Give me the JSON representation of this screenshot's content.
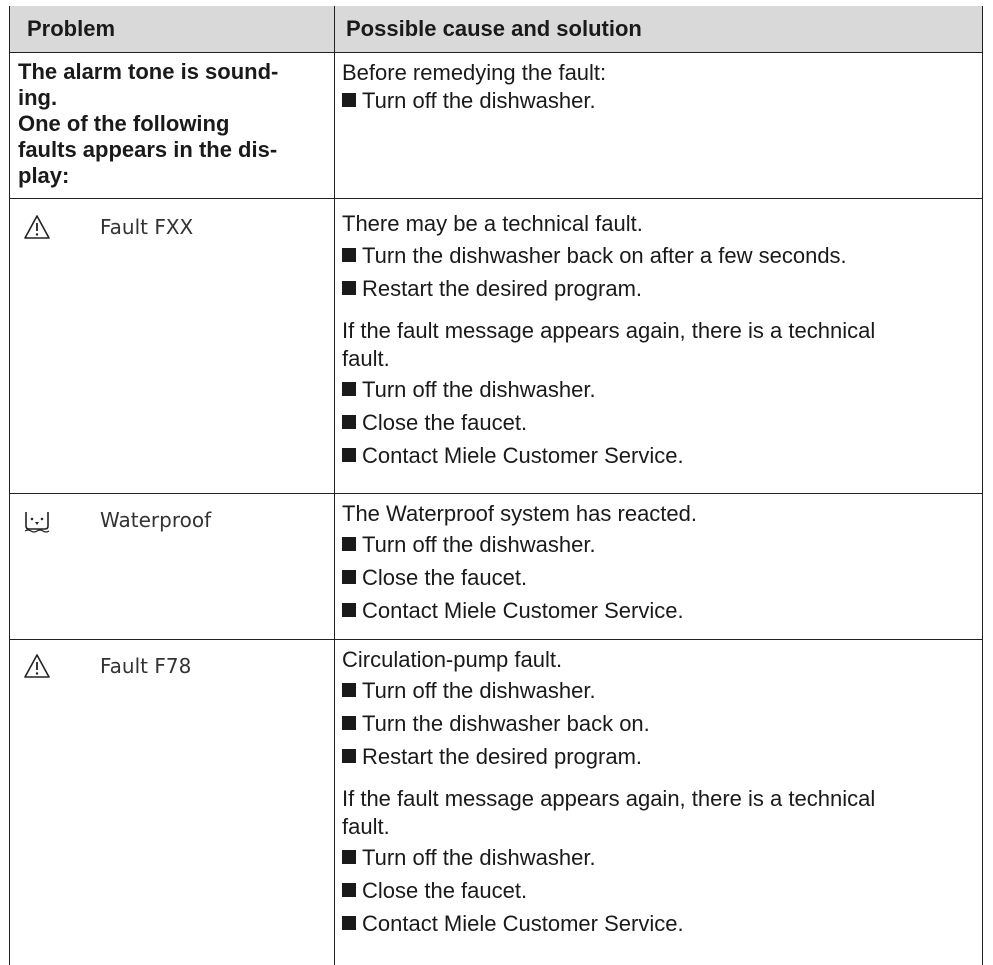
{
  "header": {
    "problem": "Problem",
    "solution": "Possible cause and solution"
  },
  "alarm": {
    "title_lines": [
      "The alarm tone is sound-",
      "ing.",
      "One of the following",
      "faults appears in the dis-",
      "play:"
    ],
    "intro": "Before remedying the fault:",
    "bullets": [
      "Turn off the dishwasher."
    ]
  },
  "fault_fxx": {
    "icon": "warning-triangle-icon",
    "code": "Fault FXX",
    "intro": "There may be a technical fault.",
    "bullets1": [
      "Turn the dishwasher back on after a few seconds.",
      "Restart the desired program."
    ],
    "again_lines": [
      "If the fault message appears again, there is a technical",
      "fault."
    ],
    "bullets2": [
      "Turn off the dishwasher.",
      "Close the faucet.",
      "Contact Miele Customer Service."
    ]
  },
  "waterproof": {
    "icon": "water-basin-icon",
    "code": "Waterproof",
    "intro": "The Waterproof system has reacted.",
    "bullets": [
      "Turn off the dishwasher.",
      "Close the faucet.",
      "Contact Miele Customer Service."
    ]
  },
  "fault_f78": {
    "icon": "warning-triangle-icon",
    "code": "Fault F78",
    "intro": "Circulation-pump fault.",
    "bullets1": [
      "Turn off the dishwasher.",
      "Turn the dishwasher back on.",
      "Restart the desired program."
    ],
    "again_lines": [
      "If the fault message appears again, there is a technical",
      "fault."
    ],
    "bullets2": [
      "Turn off the dishwasher.",
      "Close the faucet.",
      "Contact Miele Customer Service."
    ]
  }
}
